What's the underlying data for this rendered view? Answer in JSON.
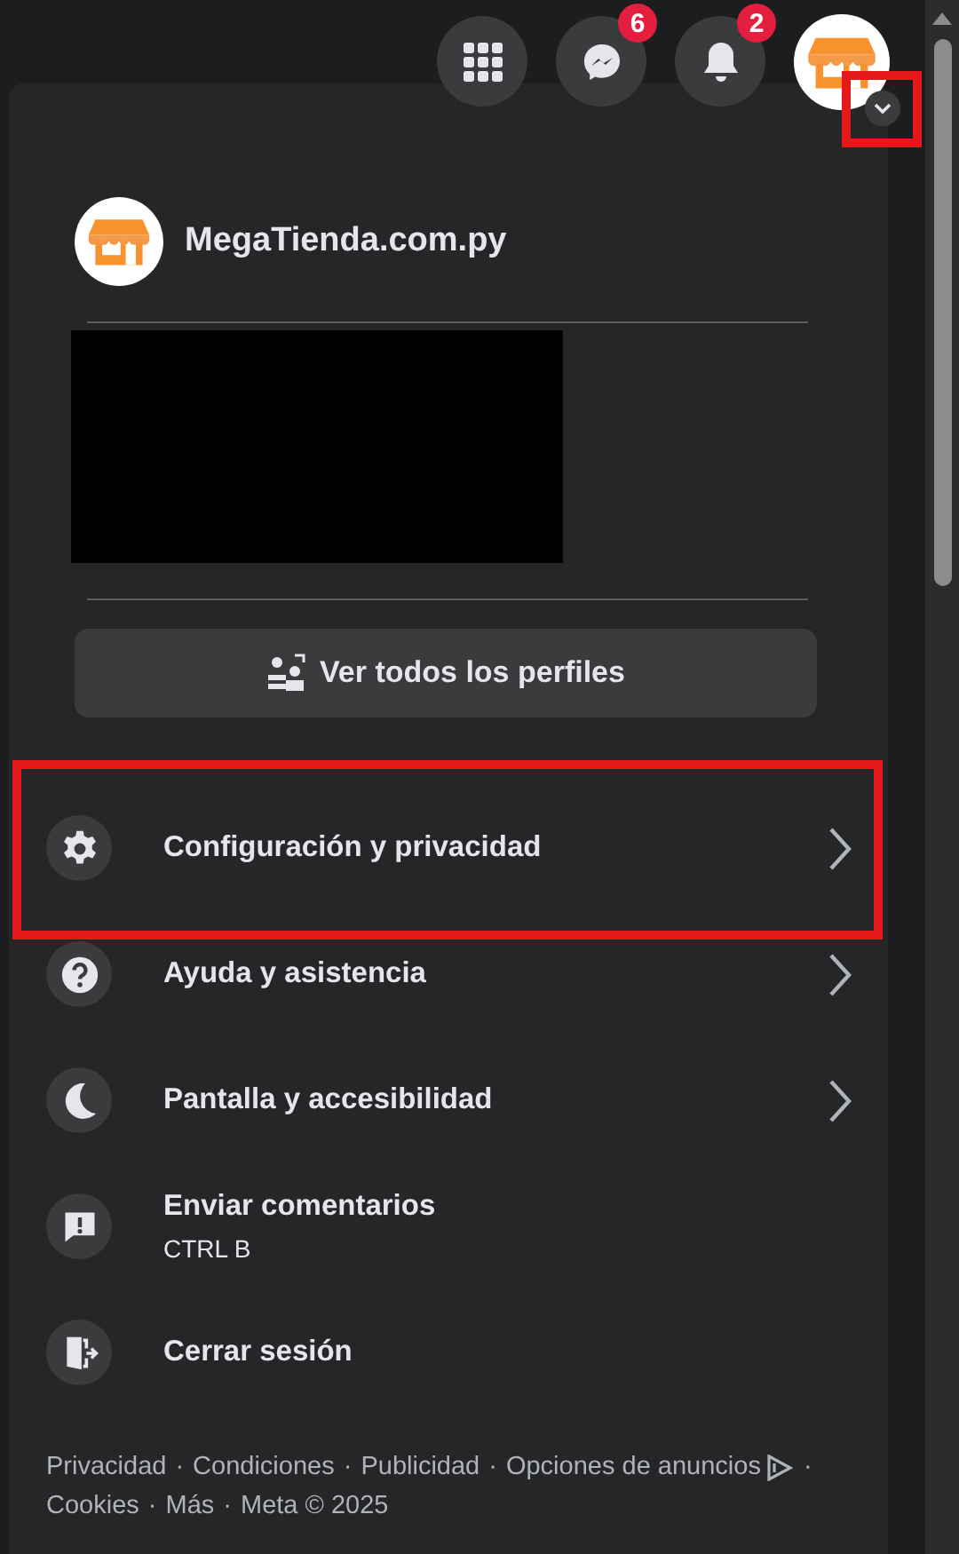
{
  "top_bar": {
    "buttons": [
      {
        "kind": "apps"
      },
      {
        "kind": "messenger",
        "badge": "6"
      },
      {
        "kind": "notifications",
        "badge": "2"
      }
    ],
    "account": {
      "kind": "store",
      "highlighted": true
    }
  },
  "menu": {
    "profile": {
      "name": "MegaTienda.com.py"
    },
    "profile_preview": {
      "kind": "redacted"
    },
    "see_all_button": "Ver todos los perfiles",
    "items": [
      {
        "kind": "nav",
        "label": "Configuración y privacidad",
        "highlighted": true
      },
      {
        "kind": "nav",
        "label": "Ayuda y asistencia",
        "highlighted": false
      },
      {
        "kind": "nav",
        "label": "Pantalla y accesibilidad",
        "highlighted": false
      },
      {
        "kind": "shortcut",
        "label": "Enviar comentarios",
        "shortcut": "CTRL B",
        "highlighted": false
      },
      {
        "kind": "action",
        "label": "Cerrar sesión",
        "highlighted": false
      }
    ],
    "footer": {
      "separator": "·",
      "links": [
        {
          "label": "Privacidad"
        },
        {
          "label": "Condiciones"
        },
        {
          "label": "Publicidad"
        },
        {
          "label": "Opciones de anuncios",
          "ad_icon": true
        },
        {
          "label": "Cookies"
        },
        {
          "label": "Más"
        }
      ],
      "copyright": "Meta © 2025"
    }
  }
}
